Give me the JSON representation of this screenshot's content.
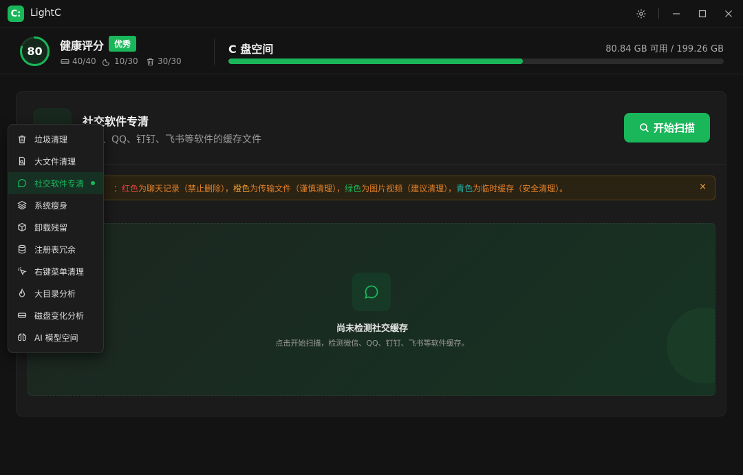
{
  "app": {
    "logo": "C:",
    "title": "LightC"
  },
  "header": {
    "score": "80",
    "health_title": "健康评分",
    "badge": "优秀",
    "stats": [
      {
        "icon": "disk-icon",
        "value": "40/40"
      },
      {
        "icon": "moon-icon",
        "value": "10/30"
      },
      {
        "icon": "trash-icon",
        "value": "30/30"
      }
    ],
    "disk_title": "C 盘空间",
    "disk_info": "80.84 GB 可用 / 199.26 GB",
    "disk_used_fraction": 0.594
  },
  "card": {
    "title": "社交软件专清",
    "desc": "微信、QQ、钉钉、飞书等软件的缓存文件",
    "scan_label": "开始扫描"
  },
  "notice": {
    "lead": "：",
    "parts": [
      {
        "text": "红色",
        "color": "#e0443e"
      },
      {
        "text": "为聊天记录（禁止删除），",
        "color": "#e0802a"
      },
      {
        "text": "橙色",
        "color": "#f0a030"
      },
      {
        "text": "为传输文件（谨慎清理），",
        "color": "#e0802a"
      },
      {
        "text": "绿色",
        "color": "#19b75a"
      },
      {
        "text": "为图片视频（建议清理），",
        "color": "#e0802a"
      },
      {
        "text": "青色",
        "color": "#22b3a8"
      },
      {
        "text": "为临时缓存（安全清理）。",
        "color": "#e0802a"
      }
    ],
    "close": "×"
  },
  "empty": {
    "title": "尚未检测社交缓存",
    "desc": "点击开始扫描，检测微信、QQ、钉钉、飞书等软件缓存。"
  },
  "menu": [
    {
      "label": "垃圾清理",
      "icon": "trash-icon"
    },
    {
      "label": "大文件清理",
      "icon": "file-search-icon"
    },
    {
      "label": "社交软件专清",
      "icon": "chat-icon",
      "active": true
    },
    {
      "label": "系统瘦身",
      "icon": "layers-icon"
    },
    {
      "label": "卸载残留",
      "icon": "box-icon"
    },
    {
      "label": "注册表冗余",
      "icon": "database-icon"
    },
    {
      "label": "右键菜单清理",
      "icon": "pointer-icon"
    },
    {
      "label": "大目录分析",
      "icon": "flame-icon"
    },
    {
      "label": "磁盘变化分析",
      "icon": "hard-drive-icon"
    },
    {
      "label": "AI 模型空间",
      "icon": "brain-icon"
    }
  ],
  "colors": {
    "accent": "#19b75a",
    "background": "#131313",
    "card": "#1b1b1b"
  }
}
